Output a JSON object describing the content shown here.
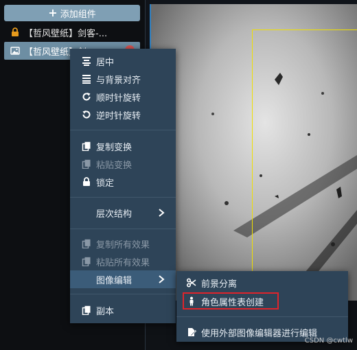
{
  "left_panel": {
    "add_button": "添加组件",
    "layers": [
      {
        "label": "【哲风壁纸】剑客-..."
      },
      {
        "label": "【哲风壁纸】剑"
      }
    ]
  },
  "context_menu": {
    "items": [
      {
        "label": "居中",
        "icon": "align-center-icon",
        "disabled": false
      },
      {
        "label": "与背景对齐",
        "icon": "align-justify-icon",
        "disabled": false
      },
      {
        "label": "顺时针旋转",
        "icon": "rotate-cw-icon",
        "disabled": false
      },
      {
        "label": "逆时针旋转",
        "icon": "rotate-ccw-icon",
        "disabled": false
      },
      {
        "label": "复制变换",
        "icon": "copy-icon",
        "disabled": false
      },
      {
        "label": "粘贴变换",
        "icon": "paste-icon",
        "disabled": true
      },
      {
        "label": "锁定",
        "icon": "lock-icon",
        "disabled": false
      },
      {
        "label": "层次结构",
        "icon": "",
        "disabled": false
      },
      {
        "label": "复制所有效果",
        "icon": "copy-icon",
        "disabled": true
      },
      {
        "label": "粘贴所有效果",
        "icon": "paste-icon",
        "disabled": true
      },
      {
        "label": "图像编辑",
        "icon": "",
        "disabled": false
      },
      {
        "label": "副本",
        "icon": "duplicate-icon",
        "disabled": false
      }
    ]
  },
  "submenu": {
    "items": [
      {
        "label": "前景分离",
        "icon": "scissors-icon"
      },
      {
        "label": "角色属性表创建",
        "icon": "person-icon"
      },
      {
        "label": "使用外部图像编辑器进行编辑",
        "icon": "external-edit-icon"
      }
    ]
  },
  "watermark": "CSDN @cwtlw",
  "colors": {
    "menu_bg": "#2e4458",
    "highlight": "#e0242b",
    "selection": "#f0e000",
    "accent": "#6d8ea3"
  }
}
